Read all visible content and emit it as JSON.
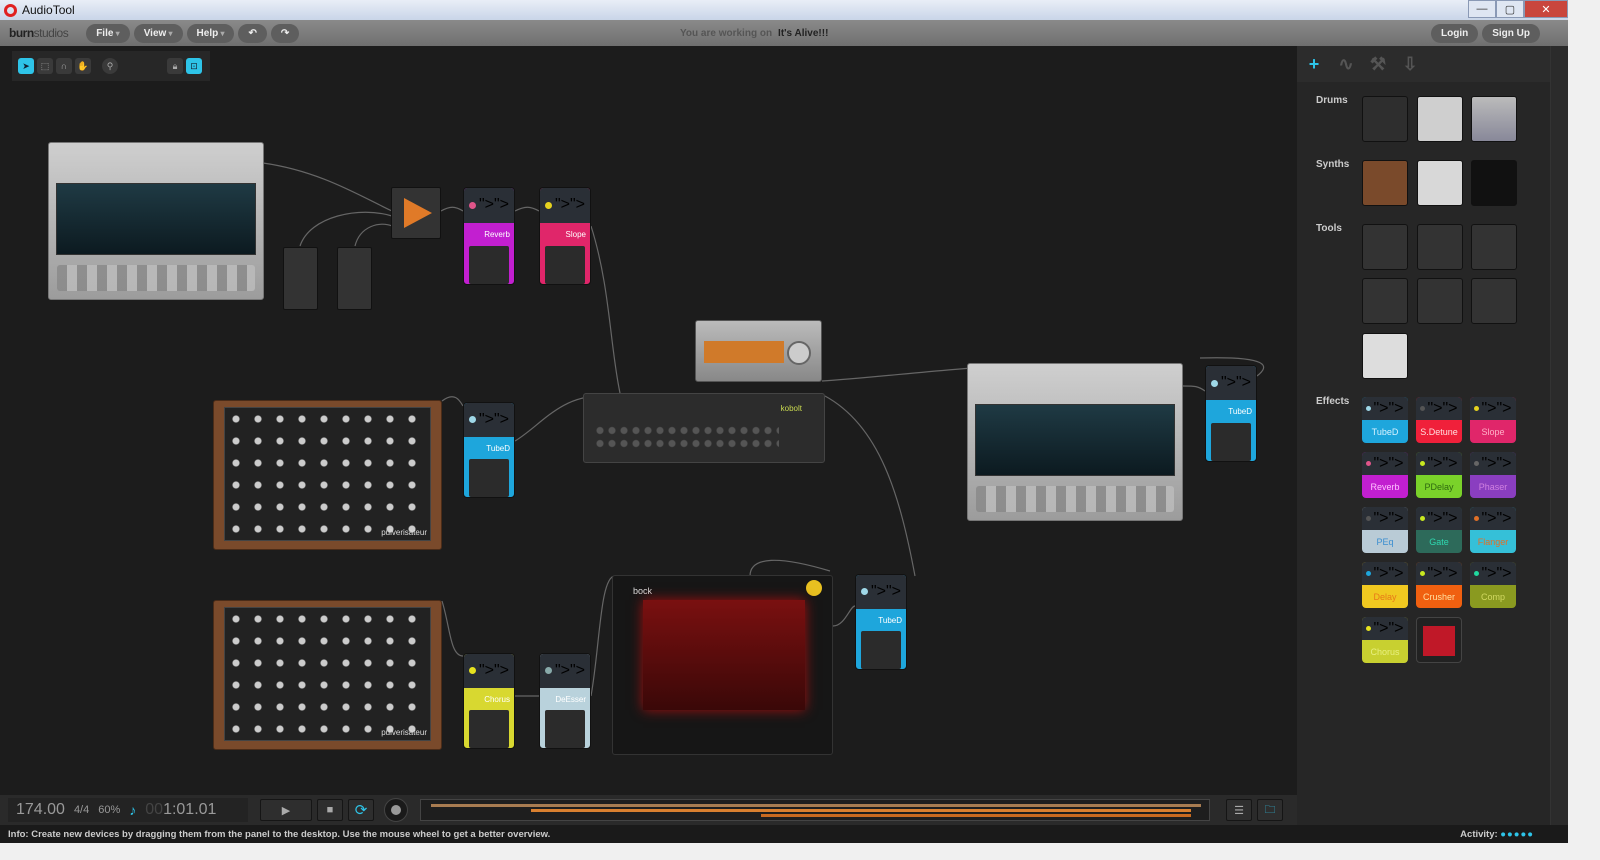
{
  "window": {
    "title": "AudioTool"
  },
  "menubar": {
    "brand_bold": "burn",
    "brand_rest": "studios",
    "menus": [
      "File",
      "View",
      "Help"
    ],
    "undo": "↶",
    "redo": "↷",
    "working_label": "You are working on",
    "project": "It's Alive!!!",
    "login": "Login",
    "signup": "Sign Up"
  },
  "canvas": {
    "pulverisateur_label": "pulverisateur",
    "kobolt_label": "kobolt",
    "bock_label": "bock",
    "pedals": [
      {
        "label": "Reverb",
        "color": "#c21fd0",
        "knob": "#e0558a"
      },
      {
        "label": "Slope",
        "color": "#e0266a",
        "knob": "#e6d21f"
      },
      {
        "label": "TubeD",
        "color": "#1ea6dc",
        "knob": "#9fd8e8"
      },
      {
        "label": "TubeD",
        "color": "#1ea6dc",
        "knob": "#9fd8e8"
      },
      {
        "label": "TubeD",
        "color": "#1ea6dc",
        "knob": "#9fd8e8"
      },
      {
        "label": "Chorus",
        "color": "#d8d830",
        "knob": "#e6e21f"
      },
      {
        "label": "DeEsser",
        "color": "#b9d2dc",
        "knob": "#8aa"
      }
    ]
  },
  "panel": {
    "tabs": [
      "add",
      "automation",
      "tools",
      "export"
    ],
    "categories": {
      "drums": "Drums",
      "synths": "Synths",
      "tools": "Tools",
      "effects": "Effects"
    },
    "effects": [
      {
        "label": "TubeD",
        "bg": "#1ea6dc",
        "fg": "#d8f2ff",
        "knob": "#9fd8e8"
      },
      {
        "label": "S.Detune",
        "bg": "#f0203a",
        "fg": "#ffdede",
        "knob": "#555"
      },
      {
        "label": "Slope",
        "bg": "#e0266a",
        "fg": "#ffb0c8",
        "knob": "#e6d21f"
      },
      {
        "label": "Reverb",
        "bg": "#c21fd0",
        "fg": "#ffc0ff",
        "knob": "#e0558a"
      },
      {
        "label": "PDelay",
        "bg": "#7ad22a",
        "fg": "#2f6a10",
        "knob": "#c8e820"
      },
      {
        "label": "Phaser",
        "bg": "#8a3ec0",
        "fg": "#d080e0",
        "knob": "#666"
      },
      {
        "label": "PEq",
        "bg": "#b9cbd6",
        "fg": "#3a8ed0",
        "knob": "#555"
      },
      {
        "label": "Gate",
        "bg": "#2d6a5a",
        "fg": "#2ed8b0",
        "knob": "#c8e820"
      },
      {
        "label": "Flanger",
        "bg": "#35c0d8",
        "fg": "#e07028",
        "knob": "#e07028"
      },
      {
        "label": "Delay",
        "bg": "#f0c820",
        "fg": "#e87818",
        "knob": "#1ea6dc"
      },
      {
        "label": "Crusher",
        "bg": "#f06010",
        "fg": "#ffe0a0",
        "knob": "#c8e820"
      },
      {
        "label": "Comp",
        "bg": "#8a9a20",
        "fg": "#d0d860",
        "knob": "#20d8a0"
      },
      {
        "label": "Chorus",
        "bg": "#c8d030",
        "fg": "#e8f080",
        "knob": "#e6e21f"
      }
    ]
  },
  "transport": {
    "tempo": "174.00",
    "signature": "4/4",
    "zoom": "60%",
    "position_dim": "00",
    "position": "1:01.01",
    "play": "▶",
    "stop": "■",
    "loop": "⟳"
  },
  "status": {
    "info": "Info: Create new devices by dragging them from the panel to the desktop. Use the mouse wheel to get a better overview.",
    "activity_label": "Activity:",
    "activity_dots": "●●●●●"
  },
  "colors": {
    "accent": "#2ec4e8"
  }
}
